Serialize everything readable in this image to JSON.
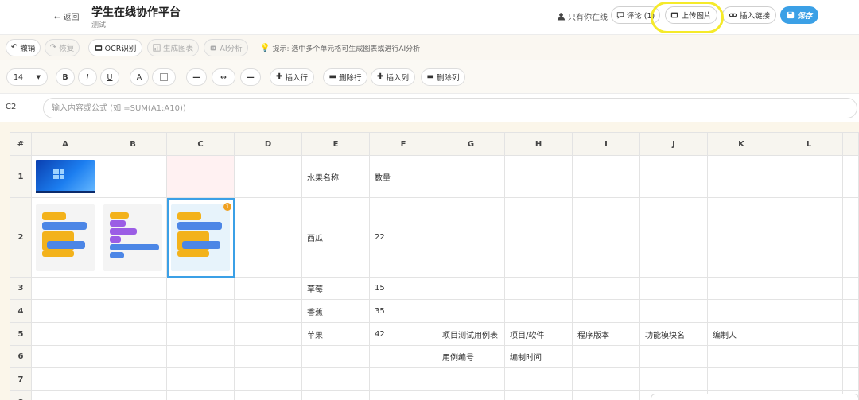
{
  "header": {
    "back_label": "← 返回",
    "title": "学生在线协作平台",
    "subtitle": "测试",
    "online_text": "只有你在线",
    "comment_label": "评论 (1)",
    "upload_label": "上传图片",
    "link_label": "插入链接",
    "save_label": "保存"
  },
  "toolbar1": {
    "undo_label": "撤销",
    "redo_label": "恢复",
    "ocr_label": "OCR识别",
    "chart_label": "生成图表",
    "ai_label": "AI分析",
    "hint_text": "提示: 选中多个单元格可生成图表或进行AI分析"
  },
  "toolbar2": {
    "font_size": "14",
    "bold": "B",
    "italic": "I",
    "underline": "U",
    "font_color": "A",
    "align_left": "—",
    "align_center": "↔",
    "align_right": "—",
    "insert_row": "插入行",
    "delete_row": "删除行",
    "insert_col": "插入列",
    "delete_col": "删除列"
  },
  "formula": {
    "cell_ref": "C2",
    "placeholder": "输入内容或公式 (如 =SUM(A1:A10))"
  },
  "grid": {
    "corner": "#",
    "columns": [
      "A",
      "B",
      "C",
      "D",
      "E",
      "F",
      "G",
      "H",
      "I",
      "J",
      "K",
      "L"
    ],
    "rows": [
      {
        "n": "1",
        "E": "水果名称",
        "F": "数量"
      },
      {
        "n": "2",
        "E": "西瓜",
        "F": "22"
      },
      {
        "n": "3",
        "E": "草莓",
        "F": "15"
      },
      {
        "n": "4",
        "E": "香蕉",
        "F": "35"
      },
      {
        "n": "5",
        "E": "苹果",
        "F": "42",
        "G": "项目测试用例表",
        "H": "项目/软件",
        "I": "程序版本",
        "J": "功能模块名",
        "K": "编制人"
      },
      {
        "n": "6",
        "G": "用例编号",
        "H": "编制时间"
      },
      {
        "n": "7"
      },
      {
        "n": "8"
      }
    ],
    "image_badge": "1"
  },
  "colors": {
    "accent": "#3ba0e6",
    "highlight": "#f5ea2a",
    "toolbar_bg": "#faf7f1"
  },
  "icons": {
    "online": "user-icon",
    "comment": "speech-bubble-icon",
    "upload": "image-icon",
    "link": "link-icon",
    "save": "floppy-disk-icon",
    "undo": "undo-icon",
    "redo": "redo-icon",
    "ocr": "scan-icon",
    "chart": "chart-icon",
    "ai": "robot-icon",
    "hint": "lightbulb-icon"
  }
}
